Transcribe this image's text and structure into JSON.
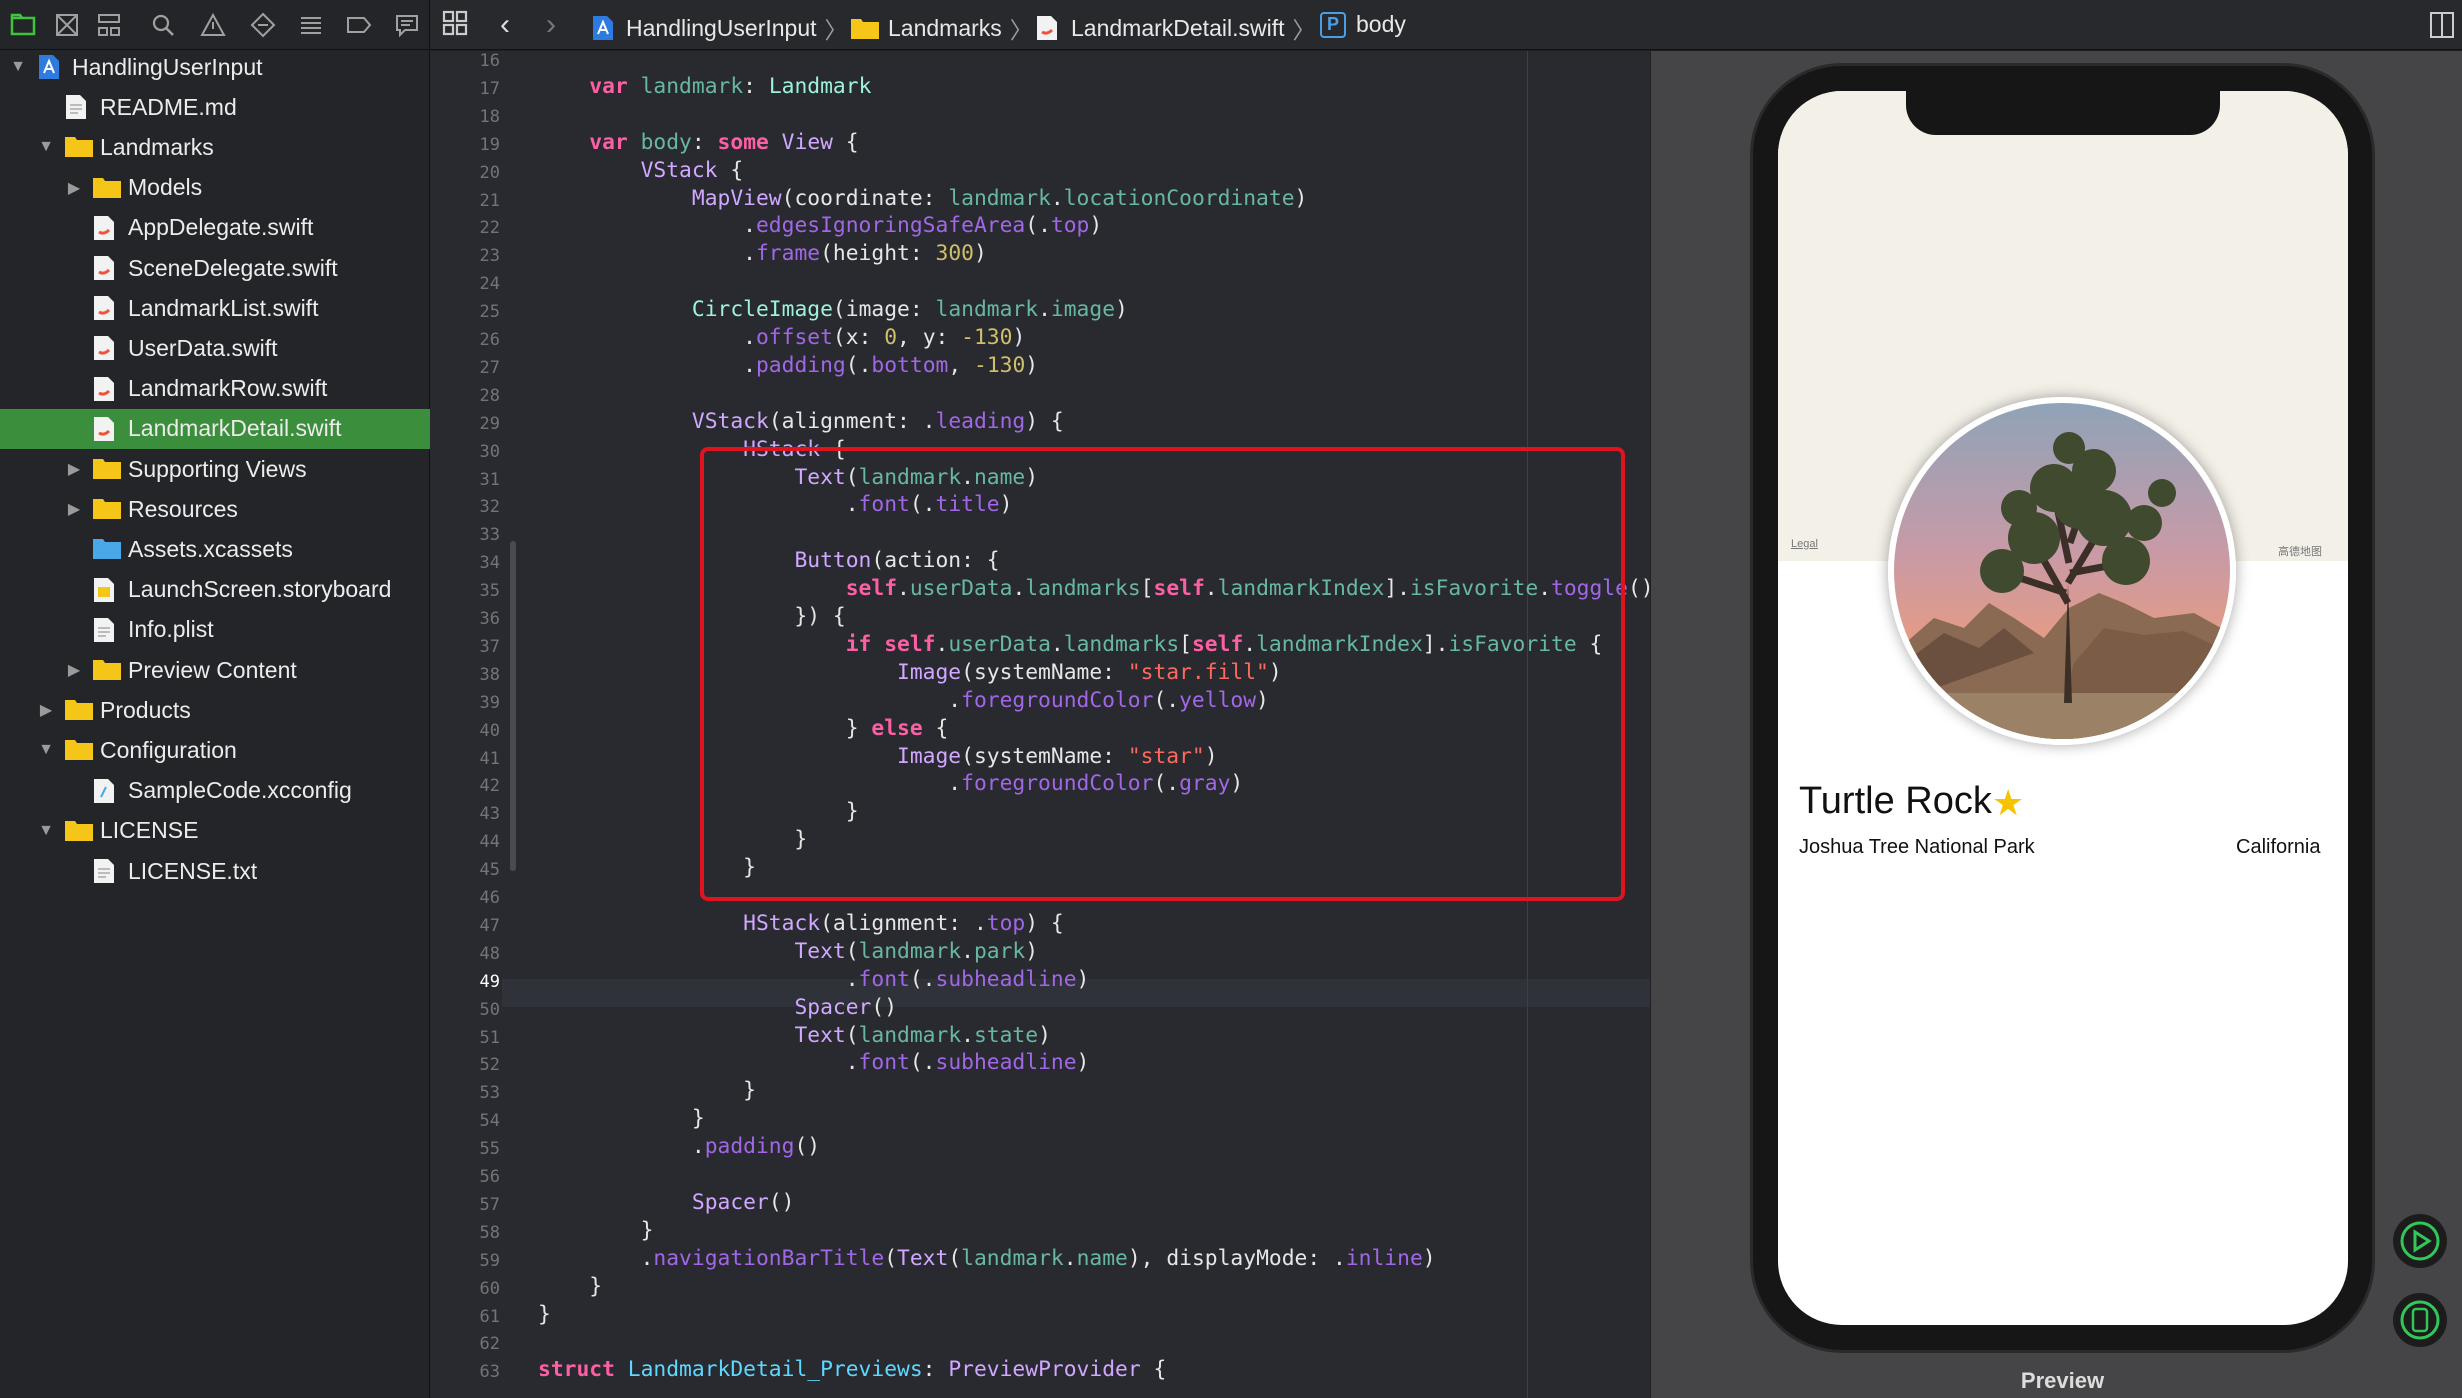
{
  "navigator": {
    "tree": [
      {
        "label": "HandlingUserInput",
        "level": 0,
        "kind": "project",
        "open": true
      },
      {
        "label": "README.md",
        "level": 1,
        "kind": "file"
      },
      {
        "label": "Landmarks",
        "level": 1,
        "kind": "folder",
        "open": true
      },
      {
        "label": "Models",
        "level": 2,
        "kind": "folder",
        "open": false
      },
      {
        "label": "AppDelegate.swift",
        "level": 2,
        "kind": "swift"
      },
      {
        "label": "SceneDelegate.swift",
        "level": 2,
        "kind": "swift"
      },
      {
        "label": "LandmarkList.swift",
        "level": 2,
        "kind": "swift"
      },
      {
        "label": "UserData.swift",
        "level": 2,
        "kind": "swift"
      },
      {
        "label": "LandmarkRow.swift",
        "level": 2,
        "kind": "swift"
      },
      {
        "label": "LandmarkDetail.swift",
        "level": 2,
        "kind": "swift",
        "selected": true
      },
      {
        "label": "Supporting Views",
        "level": 2,
        "kind": "folder",
        "open": false
      },
      {
        "label": "Resources",
        "level": 2,
        "kind": "folder",
        "open": false
      },
      {
        "label": "Assets.xcassets",
        "level": 2,
        "kind": "assets"
      },
      {
        "label": "LaunchScreen.storyboard",
        "level": 2,
        "kind": "storyboard"
      },
      {
        "label": "Info.plist",
        "level": 2,
        "kind": "file"
      },
      {
        "label": "Preview Content",
        "level": 2,
        "kind": "folder",
        "open": false
      },
      {
        "label": "Products",
        "level": 1,
        "kind": "folder",
        "open": false
      },
      {
        "label": "Configuration",
        "level": 1,
        "kind": "folder",
        "open": true
      },
      {
        "label": "SampleCode.xcconfig",
        "level": 2,
        "kind": "config"
      },
      {
        "label": "LICENSE",
        "level": 1,
        "kind": "folder",
        "open": true
      },
      {
        "label": "LICENSE.txt",
        "level": 2,
        "kind": "file"
      }
    ]
  },
  "jumpbar": {
    "project": "HandlingUserInput",
    "group": "Landmarks",
    "file": "LandmarkDetail.swift",
    "symbol_badge": "P",
    "symbol": "body"
  },
  "editor": {
    "current_line": 49,
    "lines": [
      {
        "n": 16,
        "t": []
      },
      {
        "n": 17,
        "t": [
          [
            "    ",
            ""
          ],
          [
            "var",
            "kw"
          ],
          [
            " ",
            ""
          ],
          [
            "landmark",
            "pr"
          ],
          [
            ": ",
            ""
          ],
          [
            "Landmark",
            "cls"
          ]
        ]
      },
      {
        "n": 18,
        "t": []
      },
      {
        "n": 19,
        "t": [
          [
            "    ",
            ""
          ],
          [
            "var",
            "kw"
          ],
          [
            " ",
            ""
          ],
          [
            "body",
            "pr"
          ],
          [
            ": ",
            ""
          ],
          [
            "some",
            "kw"
          ],
          [
            " ",
            ""
          ],
          [
            "View",
            "ty"
          ],
          [
            " {",
            ""
          ]
        ]
      },
      {
        "n": 20,
        "t": [
          [
            "        ",
            ""
          ],
          [
            "VStack",
            "ty"
          ],
          [
            " {",
            ""
          ]
        ]
      },
      {
        "n": 21,
        "t": [
          [
            "            ",
            ""
          ],
          [
            "MapView",
            "ty"
          ],
          [
            "(coordinate: ",
            ""
          ],
          [
            "landmark",
            "pr"
          ],
          [
            ".",
            ""
          ],
          [
            "locationCoordinate",
            "pr"
          ],
          [
            ")",
            ""
          ]
        ]
      },
      {
        "n": 22,
        "t": [
          [
            "                .",
            ""
          ],
          [
            "edgesIgnoringSafeArea",
            "mt"
          ],
          [
            "(.",
            ""
          ],
          [
            "top",
            "mt"
          ],
          [
            ")",
            ""
          ]
        ]
      },
      {
        "n": 23,
        "t": [
          [
            "                .",
            ""
          ],
          [
            "frame",
            "mt"
          ],
          [
            "(height: ",
            ""
          ],
          [
            "300",
            "nm"
          ],
          [
            ")",
            ""
          ]
        ]
      },
      {
        "n": 24,
        "t": []
      },
      {
        "n": 25,
        "t": [
          [
            "            ",
            ""
          ],
          [
            "CircleImage",
            "cls"
          ],
          [
            "(image: ",
            ""
          ],
          [
            "landmark",
            "pr"
          ],
          [
            ".",
            ""
          ],
          [
            "image",
            "pr"
          ],
          [
            ")",
            ""
          ]
        ]
      },
      {
        "n": 26,
        "t": [
          [
            "                .",
            ""
          ],
          [
            "offset",
            "mt"
          ],
          [
            "(x: ",
            ""
          ],
          [
            "0",
            "nm"
          ],
          [
            ", y: ",
            ""
          ],
          [
            "-130",
            "nm"
          ],
          [
            ")",
            ""
          ]
        ]
      },
      {
        "n": 27,
        "t": [
          [
            "                .",
            ""
          ],
          [
            "padding",
            "mt"
          ],
          [
            "(.",
            ""
          ],
          [
            "bottom",
            "mt"
          ],
          [
            ", ",
            ""
          ],
          [
            "-130",
            "nm"
          ],
          [
            ")",
            ""
          ]
        ]
      },
      {
        "n": 28,
        "t": []
      },
      {
        "n": 29,
        "t": [
          [
            "            ",
            ""
          ],
          [
            "VStack",
            "ty"
          ],
          [
            "(alignment: .",
            ""
          ],
          [
            "leading",
            "mt"
          ],
          [
            ") {",
            ""
          ]
        ]
      },
      {
        "n": 30,
        "t": [
          [
            "                ",
            ""
          ],
          [
            "HStack",
            "ty"
          ],
          [
            " {",
            ""
          ]
        ]
      },
      {
        "n": 31,
        "t": [
          [
            "                    ",
            ""
          ],
          [
            "Text",
            "ty"
          ],
          [
            "(",
            ""
          ],
          [
            "landmark",
            "pr"
          ],
          [
            ".",
            ""
          ],
          [
            "name",
            "pr"
          ],
          [
            ")",
            ""
          ]
        ]
      },
      {
        "n": 32,
        "t": [
          [
            "                        .",
            ""
          ],
          [
            "font",
            "mt"
          ],
          [
            "(.",
            ""
          ],
          [
            "title",
            "mt"
          ],
          [
            ")",
            ""
          ]
        ]
      },
      {
        "n": 33,
        "t": []
      },
      {
        "n": 34,
        "t": [
          [
            "                    ",
            ""
          ],
          [
            "Button",
            "ty"
          ],
          [
            "(action: {",
            ""
          ]
        ]
      },
      {
        "n": 35,
        "t": [
          [
            "                        ",
            ""
          ],
          [
            "self",
            "kw"
          ],
          [
            ".",
            ""
          ],
          [
            "userData",
            "pr"
          ],
          [
            ".",
            ""
          ],
          [
            "landmarks",
            "pr"
          ],
          [
            "[",
            ""
          ],
          [
            "self",
            "kw"
          ],
          [
            ".",
            ""
          ],
          [
            "landmarkIndex",
            "pr"
          ],
          [
            "].",
            ""
          ],
          [
            "isFavorite",
            "pr"
          ],
          [
            ".",
            ""
          ],
          [
            "toggle",
            "mt"
          ],
          [
            "()",
            ""
          ]
        ]
      },
      {
        "n": 36,
        "t": [
          [
            "                    }) {",
            ""
          ]
        ]
      },
      {
        "n": 37,
        "t": [
          [
            "                        ",
            ""
          ],
          [
            "if",
            "kw"
          ],
          [
            " ",
            ""
          ],
          [
            "self",
            "kw"
          ],
          [
            ".",
            ""
          ],
          [
            "userData",
            "pr"
          ],
          [
            ".",
            ""
          ],
          [
            "landmarks",
            "pr"
          ],
          [
            "[",
            ""
          ],
          [
            "self",
            "kw"
          ],
          [
            ".",
            ""
          ],
          [
            "landmarkIndex",
            "pr"
          ],
          [
            "].",
            ""
          ],
          [
            "isFavorite",
            "pr"
          ],
          [
            " {",
            ""
          ]
        ]
      },
      {
        "n": 38,
        "t": [
          [
            "                            ",
            ""
          ],
          [
            "Image",
            "ty"
          ],
          [
            "(systemName: ",
            ""
          ],
          [
            "\"star.fill\"",
            "st"
          ],
          [
            ")",
            ""
          ]
        ]
      },
      {
        "n": 39,
        "t": [
          [
            "                                .",
            ""
          ],
          [
            "foregroundColor",
            "mt"
          ],
          [
            "(.",
            ""
          ],
          [
            "yellow",
            "mt"
          ],
          [
            ")",
            ""
          ]
        ]
      },
      {
        "n": 40,
        "t": [
          [
            "                        } ",
            ""
          ],
          [
            "else",
            "kw"
          ],
          [
            " {",
            ""
          ]
        ]
      },
      {
        "n": 41,
        "t": [
          [
            "                            ",
            ""
          ],
          [
            "Image",
            "ty"
          ],
          [
            "(systemName: ",
            ""
          ],
          [
            "\"star\"",
            "st"
          ],
          [
            ")",
            ""
          ]
        ]
      },
      {
        "n": 42,
        "t": [
          [
            "                                .",
            ""
          ],
          [
            "foregroundColor",
            "mt"
          ],
          [
            "(.",
            ""
          ],
          [
            "gray",
            "mt"
          ],
          [
            ")",
            ""
          ]
        ]
      },
      {
        "n": 43,
        "t": [
          [
            "                        }",
            ""
          ]
        ]
      },
      {
        "n": 44,
        "t": [
          [
            "                    }",
            ""
          ]
        ]
      },
      {
        "n": 45,
        "t": [
          [
            "                }",
            ""
          ]
        ]
      },
      {
        "n": 46,
        "t": []
      },
      {
        "n": 47,
        "t": [
          [
            "                ",
            ""
          ],
          [
            "HStack",
            "ty"
          ],
          [
            "(alignment: .",
            ""
          ],
          [
            "top",
            "mt"
          ],
          [
            ") {",
            ""
          ]
        ]
      },
      {
        "n": 48,
        "t": [
          [
            "                    ",
            ""
          ],
          [
            "Text",
            "ty"
          ],
          [
            "(",
            ""
          ],
          [
            "landmark",
            "pr"
          ],
          [
            ".",
            ""
          ],
          [
            "park",
            "pr"
          ],
          [
            ")",
            ""
          ]
        ]
      },
      {
        "n": 49,
        "t": [
          [
            "                        .",
            ""
          ],
          [
            "font",
            "mt"
          ],
          [
            "(.",
            ""
          ],
          [
            "subheadline",
            "mt"
          ],
          [
            ")",
            ""
          ]
        ]
      },
      {
        "n": 50,
        "t": [
          [
            "                    ",
            ""
          ],
          [
            "Spacer",
            "ty"
          ],
          [
            "()",
            ""
          ]
        ]
      },
      {
        "n": 51,
        "t": [
          [
            "                    ",
            ""
          ],
          [
            "Text",
            "ty"
          ],
          [
            "(",
            ""
          ],
          [
            "landmark",
            "pr"
          ],
          [
            ".",
            ""
          ],
          [
            "state",
            "pr"
          ],
          [
            ")",
            ""
          ]
        ]
      },
      {
        "n": 52,
        "t": [
          [
            "                        .",
            ""
          ],
          [
            "font",
            "mt"
          ],
          [
            "(.",
            ""
          ],
          [
            "subheadline",
            "mt"
          ],
          [
            ")",
            ""
          ]
        ]
      },
      {
        "n": 53,
        "t": [
          [
            "                }",
            ""
          ]
        ]
      },
      {
        "n": 54,
        "t": [
          [
            "            }",
            ""
          ]
        ]
      },
      {
        "n": 55,
        "t": [
          [
            "            .",
            ""
          ],
          [
            "padding",
            "mt"
          ],
          [
            "()",
            ""
          ]
        ]
      },
      {
        "n": 56,
        "t": []
      },
      {
        "n": 57,
        "t": [
          [
            "            ",
            ""
          ],
          [
            "Spacer",
            "ty"
          ],
          [
            "()",
            ""
          ]
        ]
      },
      {
        "n": 58,
        "t": [
          [
            "        }",
            ""
          ]
        ]
      },
      {
        "n": 59,
        "t": [
          [
            "        .",
            ""
          ],
          [
            "navigationBarTitle",
            "mt"
          ],
          [
            "(",
            ""
          ],
          [
            "Text",
            "ty"
          ],
          [
            "(",
            ""
          ],
          [
            "landmark",
            "pr"
          ],
          [
            ".",
            ""
          ],
          [
            "name",
            "pr"
          ],
          [
            "), displayMode: .",
            ""
          ],
          [
            "inline",
            "mt"
          ],
          [
            ")",
            ""
          ]
        ]
      },
      {
        "n": 60,
        "t": [
          [
            "    }",
            ""
          ]
        ]
      },
      {
        "n": 61,
        "t": [
          [
            "}",
            ""
          ]
        ]
      },
      {
        "n": 62,
        "t": []
      },
      {
        "n": 63,
        "t": [
          [
            "struct",
            "kw"
          ],
          [
            " ",
            ""
          ],
          [
            "LandmarkDetail_Previews",
            "df"
          ],
          [
            ": ",
            ""
          ],
          [
            "PreviewProvider",
            "ty"
          ],
          [
            " {",
            ""
          ]
        ]
      }
    ]
  },
  "preview": {
    "map_legal": "Legal",
    "map_attribution": "高德地图",
    "landmark_name": "Turtle Rock",
    "star_glyph": "★",
    "park": "Joshua Tree National Park",
    "state": "California",
    "label": "Preview"
  },
  "colors": {
    "selection": "#3b8e3b",
    "highlight_box": "#e0141e",
    "favorite_star": "#f5c400",
    "live_button": "#31c759"
  }
}
